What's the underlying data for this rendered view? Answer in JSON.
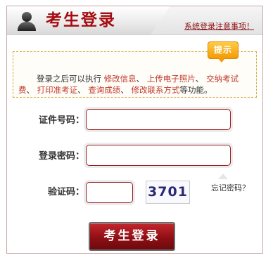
{
  "header": {
    "title": "考生登录",
    "notice_link": "系统登录注意事项！"
  },
  "tip": {
    "badge": "提示",
    "text_parts": [
      {
        "text": "登录之后可以执行 ",
        "highlight": false
      },
      {
        "text": "修改信息",
        "highlight": true
      },
      {
        "text": "、 ",
        "highlight": false
      },
      {
        "text": "上传电子照片",
        "highlight": true
      },
      {
        "text": "、 ",
        "highlight": false
      },
      {
        "text": "交纳考试费",
        "highlight": true
      },
      {
        "text": "、 ",
        "highlight": false
      },
      {
        "text": "打印准考证",
        "highlight": true
      },
      {
        "text": "、 ",
        "highlight": false
      },
      {
        "text": "查询成绩",
        "highlight": true
      },
      {
        "text": "、 ",
        "highlight": false
      },
      {
        "text": "修改联系方式",
        "highlight": true
      },
      {
        "text": "等功能。",
        "highlight": false
      }
    ]
  },
  "form": {
    "id_label": "证件号码：",
    "id_value": "",
    "password_label": "登录密码：",
    "password_value": "",
    "captcha_label": "验证码：",
    "captcha_value": "",
    "captcha_image_text": "3701",
    "forgot_password": "忘记密码？",
    "submit_label": "考生登录"
  },
  "colors": {
    "brand_red": "#a40d12",
    "tip_border": "#d6a93a",
    "tip_badge": "#f39a06"
  }
}
